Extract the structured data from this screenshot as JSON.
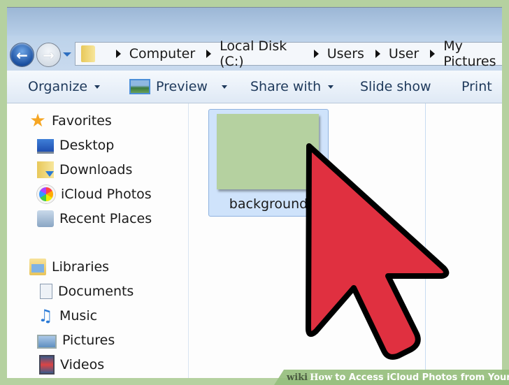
{
  "window": {
    "breadcrumb": [
      "Computer",
      "Local Disk (C:)",
      "Users",
      "User",
      "My Pictures"
    ],
    "nav_icons": {
      "back": "back-arrow-icon",
      "forward": "forward-arrow-icon",
      "history": "chevron-down-icon",
      "location": "folder-icon"
    }
  },
  "toolbar": {
    "organize": "Organize",
    "preview": "Preview",
    "share_with": "Share with",
    "slide_show": "Slide show",
    "print": "Print"
  },
  "sidebar": {
    "favorites": {
      "label": "Favorites",
      "items": [
        {
          "label": "Desktop",
          "icon": "desktop-icon"
        },
        {
          "label": "Downloads",
          "icon": "downloads-folder-icon"
        },
        {
          "label": "iCloud Photos",
          "icon": "icloud-photos-icon"
        },
        {
          "label": "Recent Places",
          "icon": "recent-places-icon"
        }
      ]
    },
    "libraries": {
      "label": "Libraries",
      "items": [
        {
          "label": "Documents",
          "icon": "documents-icon"
        },
        {
          "label": "Music",
          "icon": "music-icon"
        },
        {
          "label": "Pictures",
          "icon": "pictures-icon"
        },
        {
          "label": "Videos",
          "icon": "videos-icon"
        }
      ]
    }
  },
  "files": [
    {
      "name": "background",
      "selected": true,
      "thumb_color": "#b5d1a0"
    }
  ],
  "overlay": {
    "cursor_color": "#e03040",
    "watermark": {
      "wiki": "wiki",
      "how": "How",
      "title": "to Access iCloud Photos from Your PC"
    }
  }
}
